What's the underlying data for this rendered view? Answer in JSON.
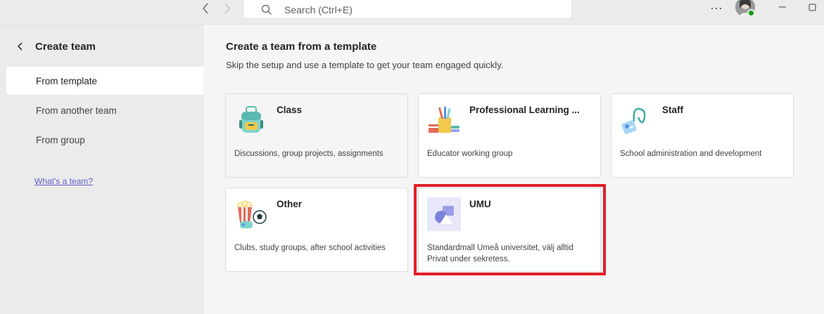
{
  "topbar": {
    "search_placeholder": "Search (Ctrl+E)",
    "more_label": "···"
  },
  "sidebar": {
    "back_title": "Create team",
    "items": [
      {
        "label": "From template",
        "active": true
      },
      {
        "label": "From another team",
        "active": false
      },
      {
        "label": "From group",
        "active": false
      }
    ],
    "help_link": "What's a team?"
  },
  "main": {
    "title": "Create a team from a template",
    "subtitle": "Skip the setup and use a template to get your team engaged quickly."
  },
  "templates": [
    {
      "title": "Class",
      "description": "Discussions, group projects, assignments",
      "icon": "backpack-icon"
    },
    {
      "title": "Professional Learning ...",
      "description": "Educator working group",
      "icon": "books-pencils-icon"
    },
    {
      "title": "Staff",
      "description": "School administration and development",
      "icon": "id-badge-lanyard-icon"
    },
    {
      "title": "Other",
      "description": "Clubs, study groups, after school activities",
      "icon": "popcorn-ball-icon"
    },
    {
      "title": "UMU",
      "description": "Standardmall Umeå universitet, välj alltid Privat under sekretess.",
      "icon": "shapes-icon"
    }
  ],
  "colors": {
    "accent": "#5b5fc7",
    "highlight": "#e0202a",
    "presence": "#13a10e"
  }
}
